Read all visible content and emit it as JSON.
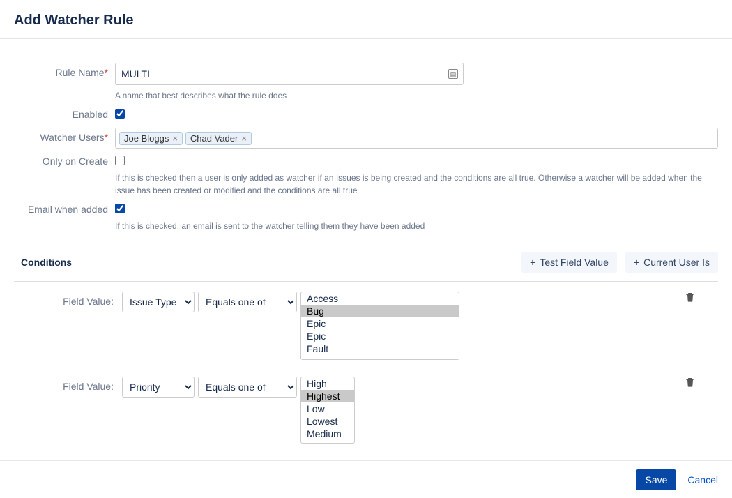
{
  "header": {
    "title": "Add Watcher Rule"
  },
  "form": {
    "rule_name": {
      "label": "Rule Name",
      "value": "MULTI",
      "hint": "A name that best describes what the rule does"
    },
    "enabled": {
      "label": "Enabled",
      "checked": true
    },
    "watcher_users": {
      "label": "Watcher Users",
      "tags": [
        "Joe Bloggs",
        "Chad Vader"
      ]
    },
    "only_on_create": {
      "label": "Only on Create",
      "checked": false,
      "hint": "If this is checked then a user is only added as watcher if an Issues is being created and the conditions are all true. Otherwise a watcher will be added when the issue has been created or modified and the conditions are all true"
    },
    "email_when_added": {
      "label": "Email when added",
      "checked": true,
      "hint": "If this is checked, an email is sent to the watcher telling them they have been added"
    }
  },
  "conditions_section": {
    "title": "Conditions",
    "btn_test": "Test Field Value",
    "btn_current_user": "Current User Is"
  },
  "conditions": [
    {
      "label": "Field Value:",
      "field": "Issue Type",
      "operator": "Equals one of",
      "list_width": 228,
      "list_height": 96,
      "options": [
        {
          "text": "Access",
          "selected": false
        },
        {
          "text": "Bug",
          "selected": true
        },
        {
          "text": "Epic",
          "selected": false
        },
        {
          "text": "Epic",
          "selected": false
        },
        {
          "text": "Fault",
          "selected": false
        }
      ]
    },
    {
      "label": "Field Value:",
      "field": "Priority",
      "operator": "Equals one of",
      "list_width": 78,
      "list_height": 94,
      "options": [
        {
          "text": "High",
          "selected": false
        },
        {
          "text": "Highest",
          "selected": true
        },
        {
          "text": "Low",
          "selected": false
        },
        {
          "text": "Lowest",
          "selected": false
        },
        {
          "text": "Medium",
          "selected": false
        }
      ]
    }
  ],
  "footer": {
    "save": "Save",
    "cancel": "Cancel"
  }
}
